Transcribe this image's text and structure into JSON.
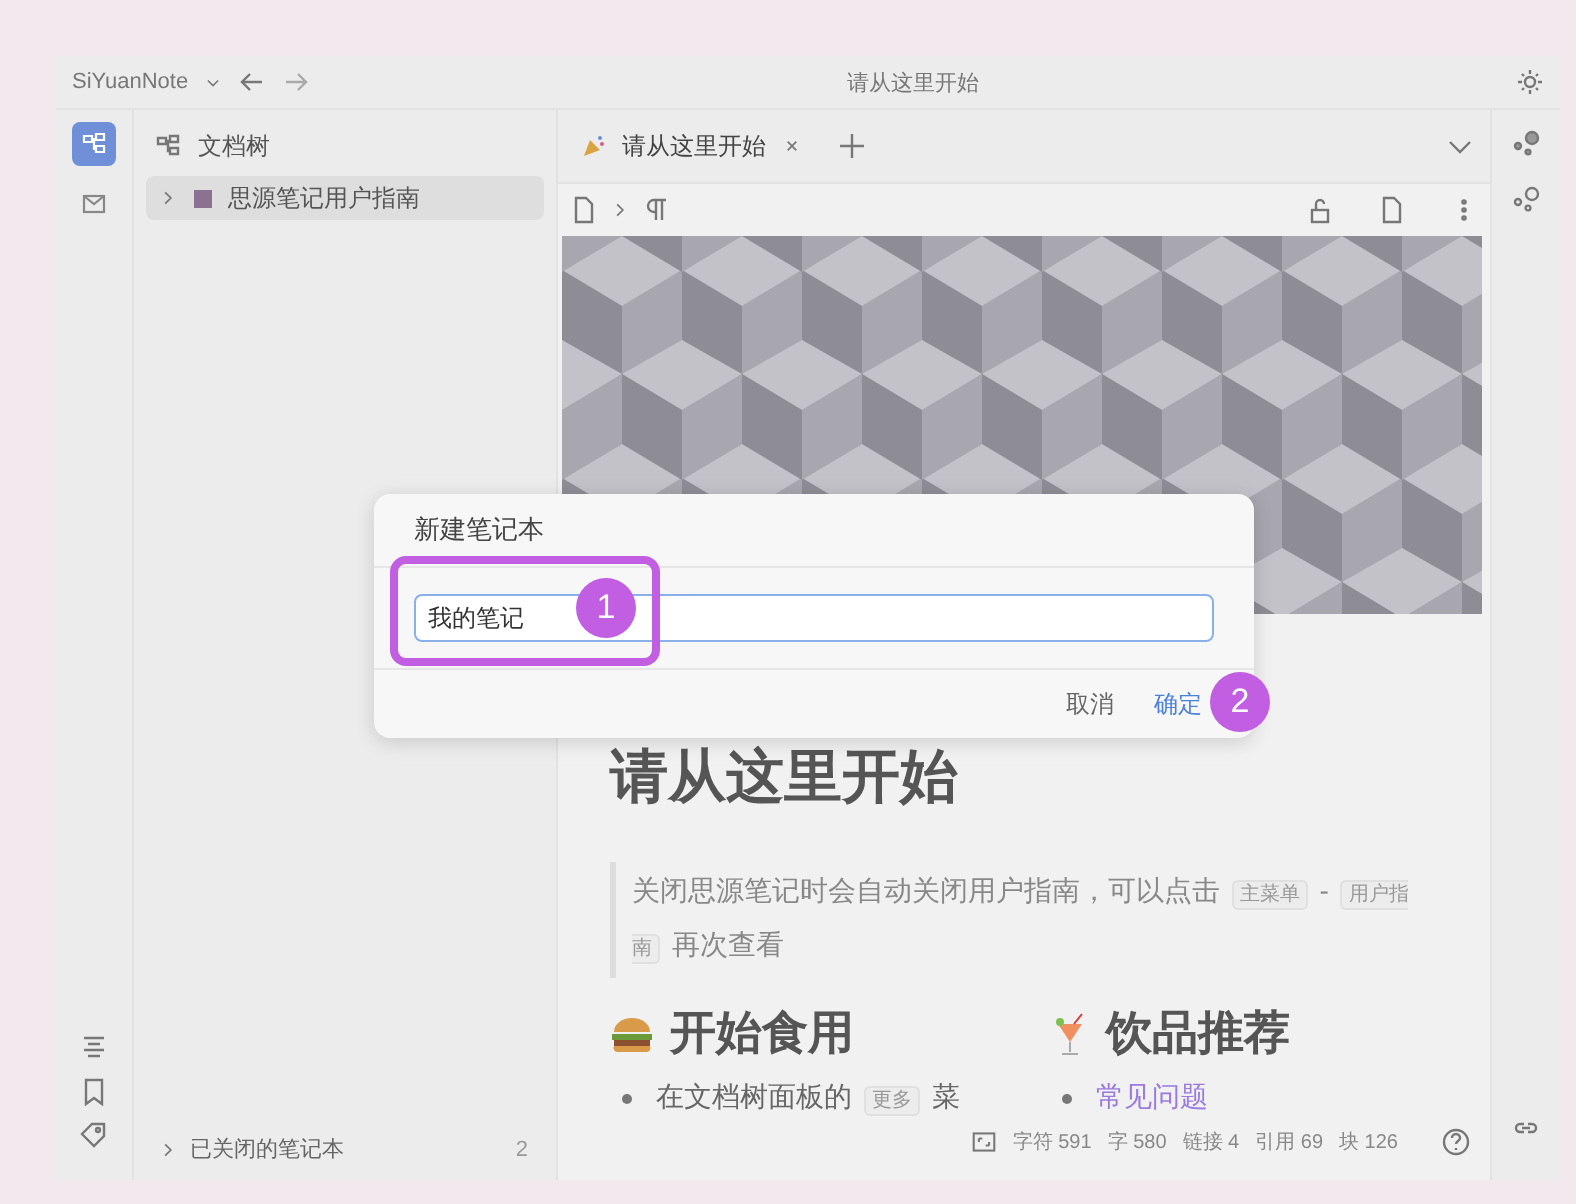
{
  "window": {
    "app_menu": "SiYuanNote",
    "title": "请从这里开始"
  },
  "dock": [
    {
      "kind": "tree",
      "selected": true
    },
    {
      "kind": "inbox",
      "selected": false
    }
  ],
  "file_tree": {
    "title": "文档树",
    "notebooks": [
      {
        "name": "思源笔记用户指南",
        "color": "#8a7290",
        "selected": true
      }
    ],
    "closed": {
      "label": "已关闭的笔记本",
      "count": "2"
    }
  },
  "tabs": [
    {
      "label": "请从这里开始",
      "selected": true
    }
  ],
  "editor": {
    "title": "请从这里开始",
    "note": [
      {
        "kind": "text",
        "text": "关闭思源笔记时会自动关闭用户指南，可以点击 "
      },
      {
        "kind": "key",
        "text": "主菜单"
      },
      {
        "kind": "text",
        "text": " - "
      },
      {
        "kind": "key",
        "text": "用户指南"
      },
      {
        "kind": "text",
        "text": " 再次查看"
      }
    ],
    "sections": [
      {
        "heading": "开始食用",
        "item": [
          {
            "kind": "text",
            "text": "在文档树面板的 "
          },
          {
            "kind": "key",
            "text": "更多"
          },
          {
            "kind": "text",
            "text": " 菜"
          }
        ]
      },
      {
        "heading": "饮品推荐",
        "item": [
          {
            "kind": "link",
            "text": "常见问题"
          }
        ]
      }
    ]
  },
  "status_bar": [
    "字符 591",
    "字 580",
    "链接 4",
    "引用 69",
    "块 126"
  ],
  "dialog": {
    "title": "新建笔记本",
    "value": "我的笔记",
    "buttons": [
      {
        "label": "取消",
        "primary": false
      },
      {
        "label": "确定",
        "primary": true
      }
    ]
  },
  "annotations": [
    "1",
    "2"
  ]
}
